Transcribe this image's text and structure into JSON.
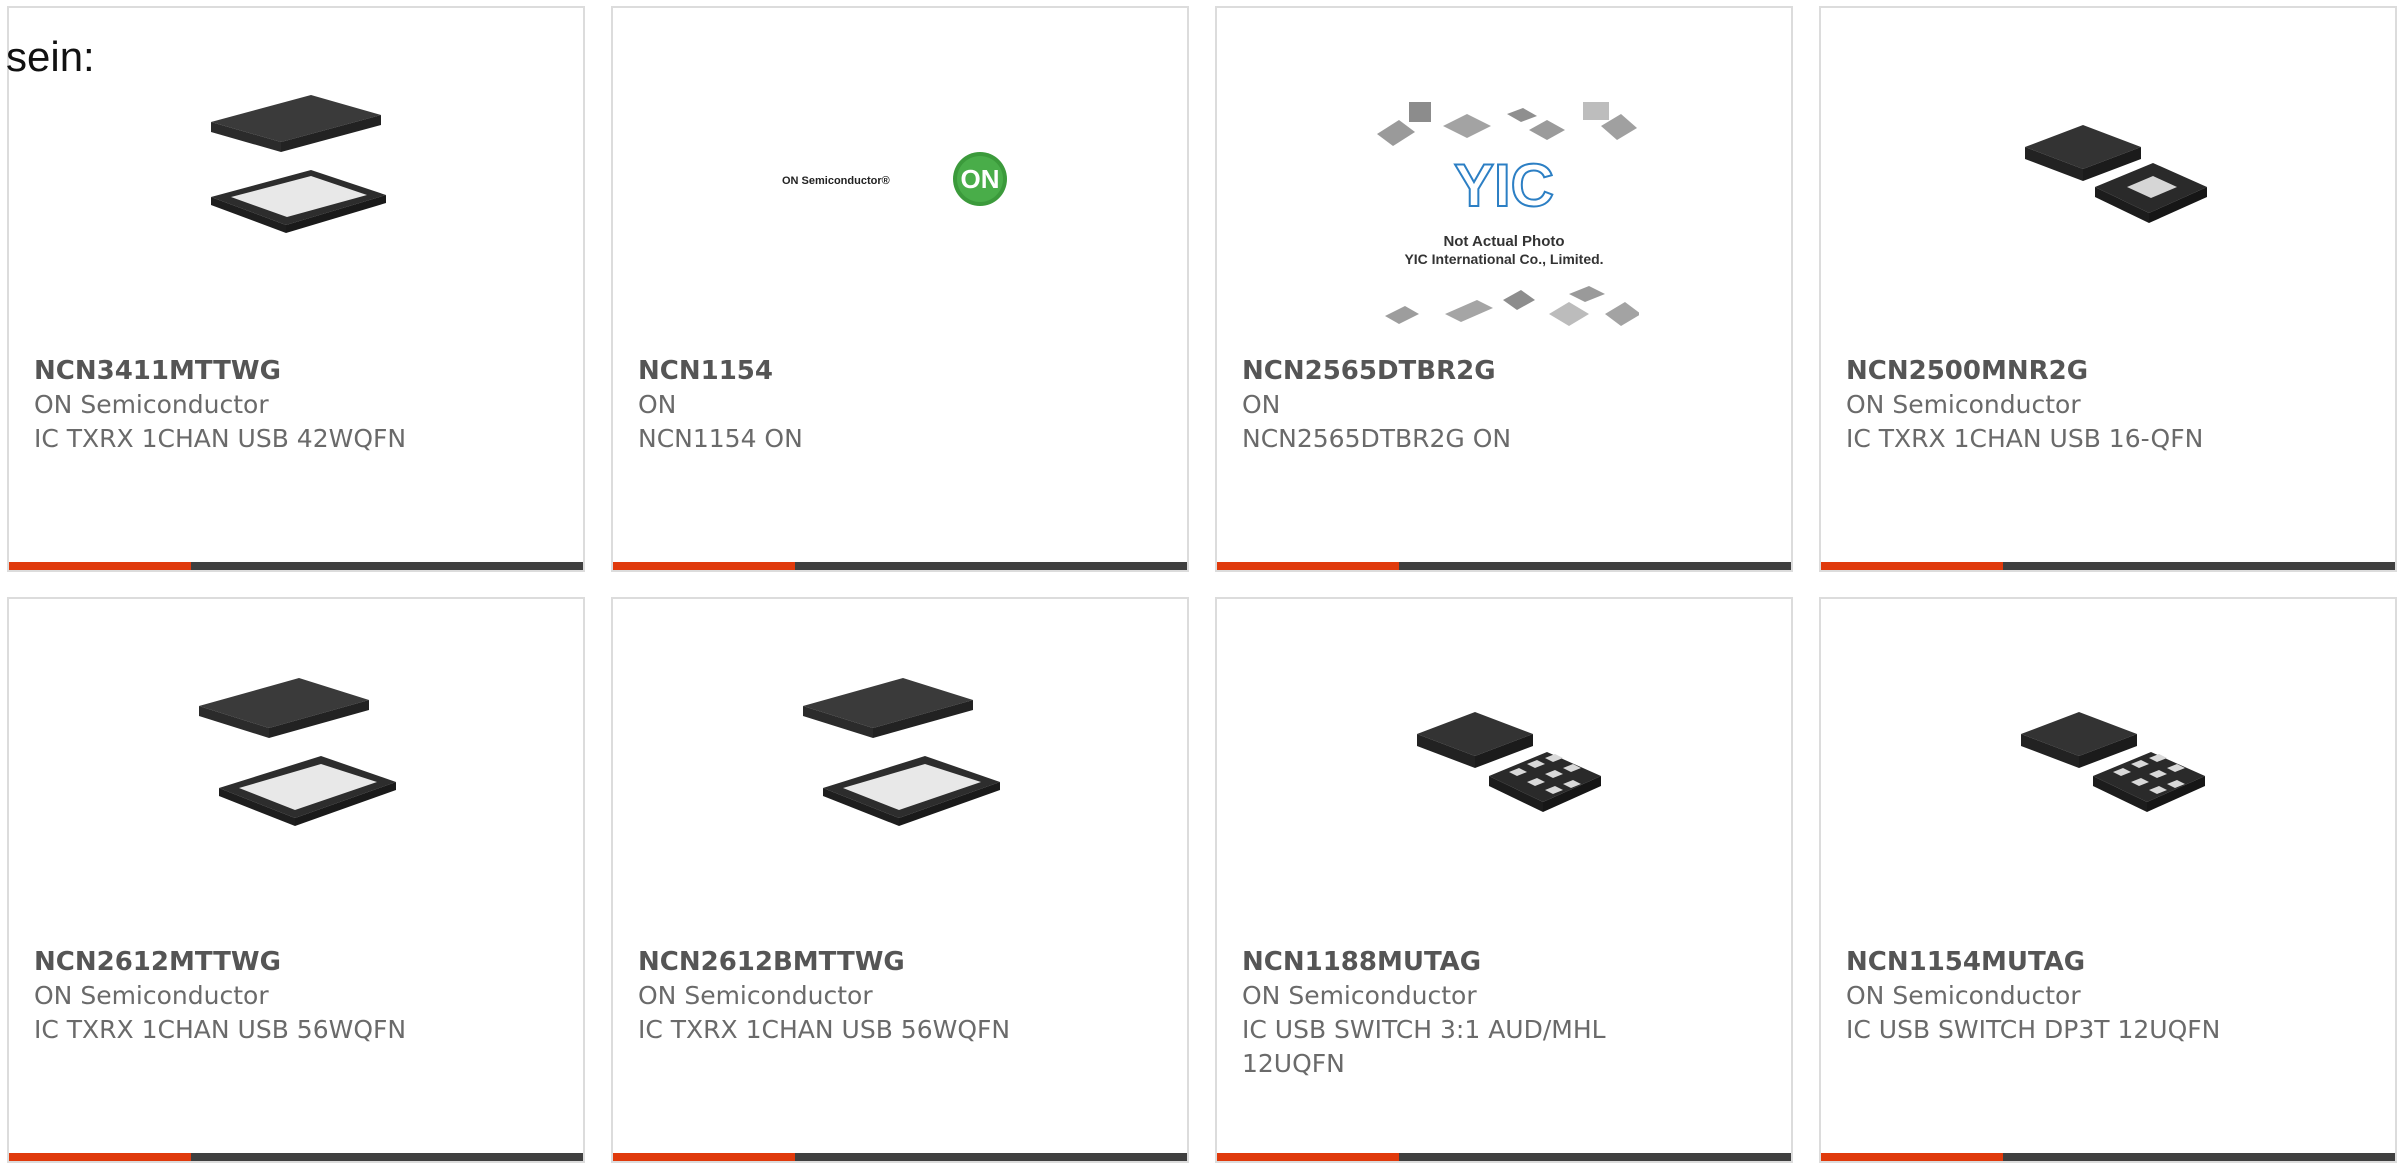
{
  "page": {
    "label": "sein:"
  },
  "colors": {
    "accent": "#e03a0c",
    "bar": "#3f3f3f",
    "border": "#dcdcdc",
    "text": "#6a6a6a"
  },
  "products": [
    {
      "part": "NCN3411MTTWG",
      "maker": "ON Semiconductor",
      "desc": "IC TXRX 1CHAN USB 42WQFN",
      "image": "wqfn-chip-icon"
    },
    {
      "part": "NCN1154",
      "maker": "ON",
      "desc": "NCN1154 ON",
      "image": "on-semiconductor-logo",
      "logo": {
        "wordmark": "ON Semiconductor®",
        "badge": "ON"
      }
    },
    {
      "part": "NCN2565DTBR2G",
      "maker": "ON",
      "desc": "NCN2565DTBR2G ON",
      "image": "not-actual-photo-placeholder",
      "placeholder": {
        "mark": "YIC",
        "line1": "Not Actual Photo",
        "line2": "YIC International Co., Limited."
      }
    },
    {
      "part": "NCN2500MNR2G",
      "maker": "ON Semiconductor",
      "desc": "IC TXRX 1CHAN USB 16-QFN",
      "image": "qfn-chip-icon"
    },
    {
      "part": "NCN2612MTTWG",
      "maker": "ON Semiconductor",
      "desc": "IC TXRX 1CHAN USB 56WQFN",
      "image": "wqfn-chip-icon"
    },
    {
      "part": "NCN2612BMTTWG",
      "maker": "ON Semiconductor",
      "desc": "IC TXRX 1CHAN USB 56WQFN",
      "image": "wqfn-chip-icon"
    },
    {
      "part": "NCN1188MUTAG",
      "maker": "ON Semiconductor",
      "desc": "IC USB SWITCH 3:1 AUD/MHL 12UQFN",
      "image": "uqfn-chip-icon"
    },
    {
      "part": "NCN1154MUTAG",
      "maker": "ON Semiconductor",
      "desc": "IC USB SWITCH DP3T 12UQFN",
      "image": "uqfn-chip-icon"
    }
  ]
}
